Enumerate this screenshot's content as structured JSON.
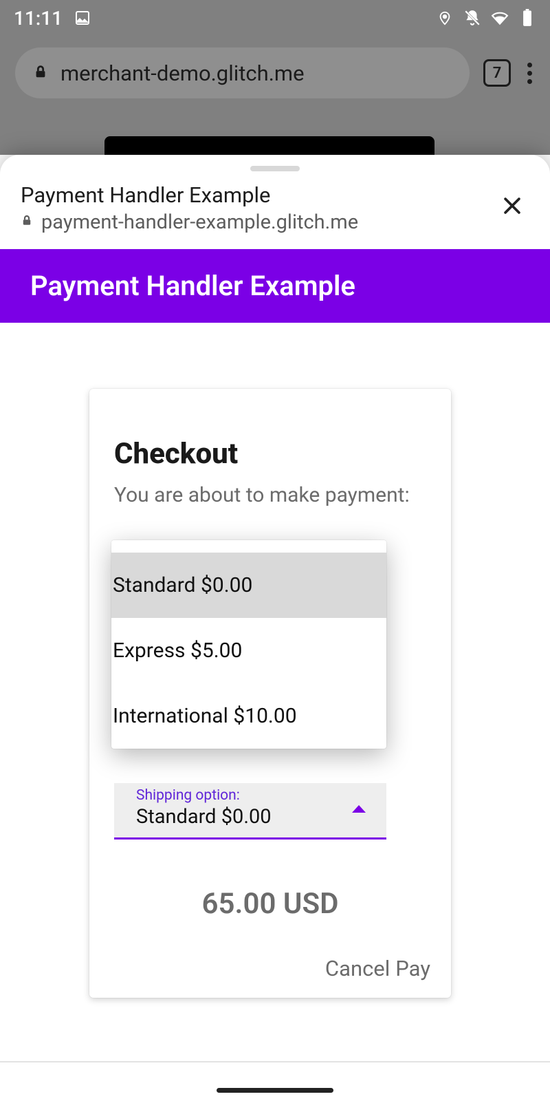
{
  "status": {
    "time": "11:11",
    "tab_count": "7"
  },
  "browser": {
    "url": "merchant-demo.glitch.me"
  },
  "sheet": {
    "title": "Payment Handler Example",
    "origin": "payment-handler-example.glitch.me"
  },
  "header": {
    "title": "Payment Handler Example"
  },
  "checkout": {
    "title": "Checkout",
    "subtitle": "You are about to make payment:",
    "shipping_label": "Shipping option:",
    "shipping_selected": "Standard $0.00",
    "options": [
      "Standard $0.00",
      "Express $5.00",
      "International $10.00"
    ],
    "total": "65.00 USD",
    "cancel_label": "Cancel",
    "pay_label": "Pay"
  }
}
